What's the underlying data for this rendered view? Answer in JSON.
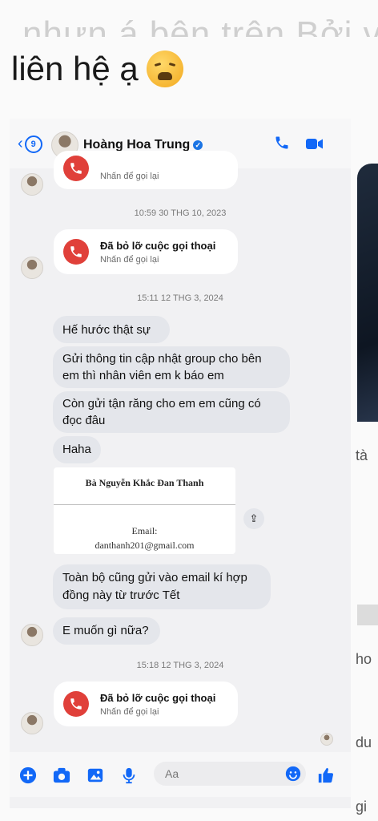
{
  "headline": {
    "top_partial": "nhưn á bên trên Bởi vì",
    "text": "liên hệ ạ"
  },
  "chat": {
    "contact_name": "Hoàng Hoa Trung",
    "back_badge": "9",
    "missed_call_title": "Đã bỏ lỡ cuộc gọi thoại",
    "missed_call_sub": "Nhấn để gọi lại",
    "timestamps": [
      "10:59 30 THG 10, 2023",
      "15:11 12 THG 3, 2024",
      "15:18 12 THG 3, 2024"
    ],
    "messages": [
      "Hế hước thật sự",
      "Gửi thông tin cập nhật group cho bên",
      "em thì nhân viên em k báo em",
      "Còn gửi tận răng cho em em cũng có",
      "đọc đâu",
      "Haha",
      "Toàn bộ cũng gửi vào email kí hợp",
      "đồng này từ trước Tết",
      "E muốn gì nữa?"
    ],
    "attachment": {
      "name": "Bà Nguyễn Khắc Đan Thanh",
      "email_label": "Email:",
      "email_value": "danthanh201@gmail.com"
    },
    "composer_placeholder": "Aa"
  },
  "right_fragments": [
    "tà",
    "ho",
    "du",
    "gi"
  ],
  "colors": {
    "accent": "#1268f7",
    "missed_call": "#e0403a",
    "bubble": "#e4e6eb"
  }
}
